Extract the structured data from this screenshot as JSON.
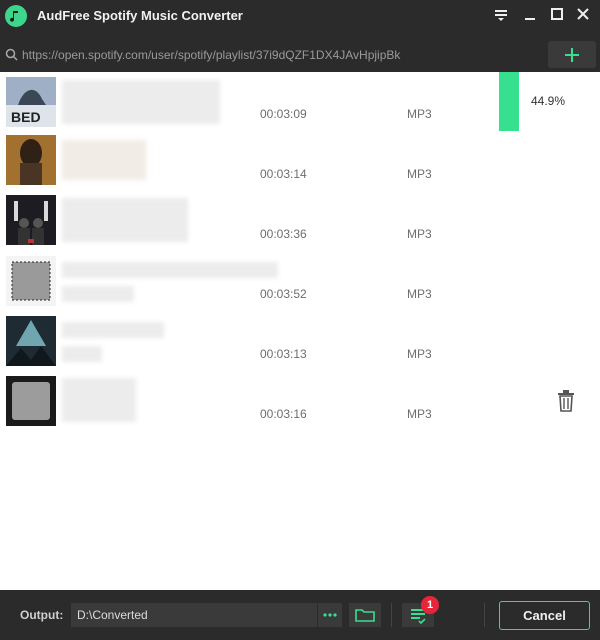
{
  "app": {
    "title": "AudFree Spotify Music Converter",
    "logo_icon": "music-note-icon",
    "accent": "#37e08e"
  },
  "window_controls": [
    "menu-icon",
    "minimize-icon",
    "maximize-icon",
    "close-icon"
  ],
  "url_bar": {
    "value": "https://open.spotify.com/user/spotify/playlist/37i9dQZF1DX4JAvHpjipBk",
    "add_icon": "plus-icon"
  },
  "tracks": [
    {
      "duration": "00:03:09",
      "format": "MP3"
    },
    {
      "duration": "00:03:14",
      "format": "MP3"
    },
    {
      "duration": "00:03:36",
      "format": "MP3"
    },
    {
      "duration": "00:03:52",
      "format": "MP3"
    },
    {
      "duration": "00:03:13",
      "format": "MP3"
    },
    {
      "duration": "00:03:16",
      "format": "MP3"
    }
  ],
  "conversion": {
    "progress_text": "44.9%",
    "progress_fraction": 0.449
  },
  "footer": {
    "output_label": "Output:",
    "output_path": "D:\\Converted",
    "more_label": "···",
    "badge_count": "1",
    "cancel_label": "Cancel"
  }
}
